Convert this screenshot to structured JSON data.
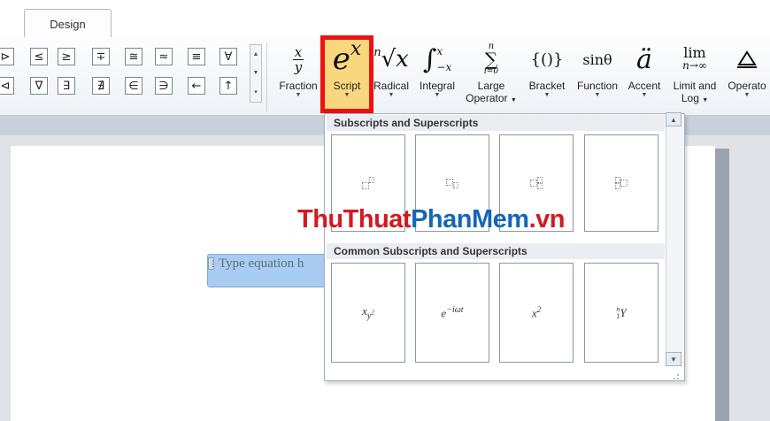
{
  "ribbon": {
    "tab_label": "Design",
    "symbols_row1": [
      "⊳",
      "≤",
      "≥",
      "∓",
      "≅",
      "≈",
      "≡",
      "∀"
    ],
    "symbols_row2": [
      "⊲",
      "∇",
      "∃",
      "∄",
      "∈",
      "∋",
      "←",
      "↑"
    ],
    "buttons": [
      {
        "id": "fraction",
        "label": "Fraction"
      },
      {
        "id": "script",
        "label": "Script"
      },
      {
        "id": "radical",
        "label": "Radical"
      },
      {
        "id": "integral",
        "label": "Integral"
      },
      {
        "id": "large_operator",
        "label": "Large",
        "label2": "Operator"
      },
      {
        "id": "bracket",
        "label": "Bracket"
      },
      {
        "id": "function",
        "label": "Function"
      },
      {
        "id": "accent",
        "label": "Accent"
      },
      {
        "id": "limit_log",
        "label": "Limit and",
        "label2": "Log"
      },
      {
        "id": "operator",
        "label": "Operato"
      }
    ],
    "icons": {
      "fraction_num": "x",
      "fraction_den": "y",
      "script_base": "e",
      "script_sup": "x",
      "radical_index": "n",
      "radical_body": "√x",
      "integral": "∫",
      "integral_upper": "x",
      "integral_lower": "−x",
      "sum_upper": "n",
      "sum_symbol": "∑",
      "sum_lower": "i=0",
      "bracket": "{()}",
      "function": "sinθ",
      "accent": "ä",
      "limit_top": "lim",
      "limit_bottom": "n→∞"
    }
  },
  "document": {
    "equation_placeholder": "Type equation h"
  },
  "dropdown": {
    "section1_title": "Subscripts and Superscripts",
    "section2_title": "Common Subscripts and Superscripts",
    "common": [
      {
        "base": "x",
        "sub": "y",
        "subsup": "2"
      },
      {
        "base": "e",
        "sup": "−iωt"
      },
      {
        "base": "x",
        "sup": "2"
      },
      {
        "pre_sup": "n",
        "pre_sub": "1",
        "base": "Y"
      }
    ]
  },
  "watermark": {
    "part1": "ThuThuat",
    "part2": "PhanMem",
    "part3": ".vn"
  },
  "colors": {
    "highlight_border": "#ee1111",
    "highlight_fill": "#f9d77e",
    "equation_fill": "#a9cdf0"
  }
}
